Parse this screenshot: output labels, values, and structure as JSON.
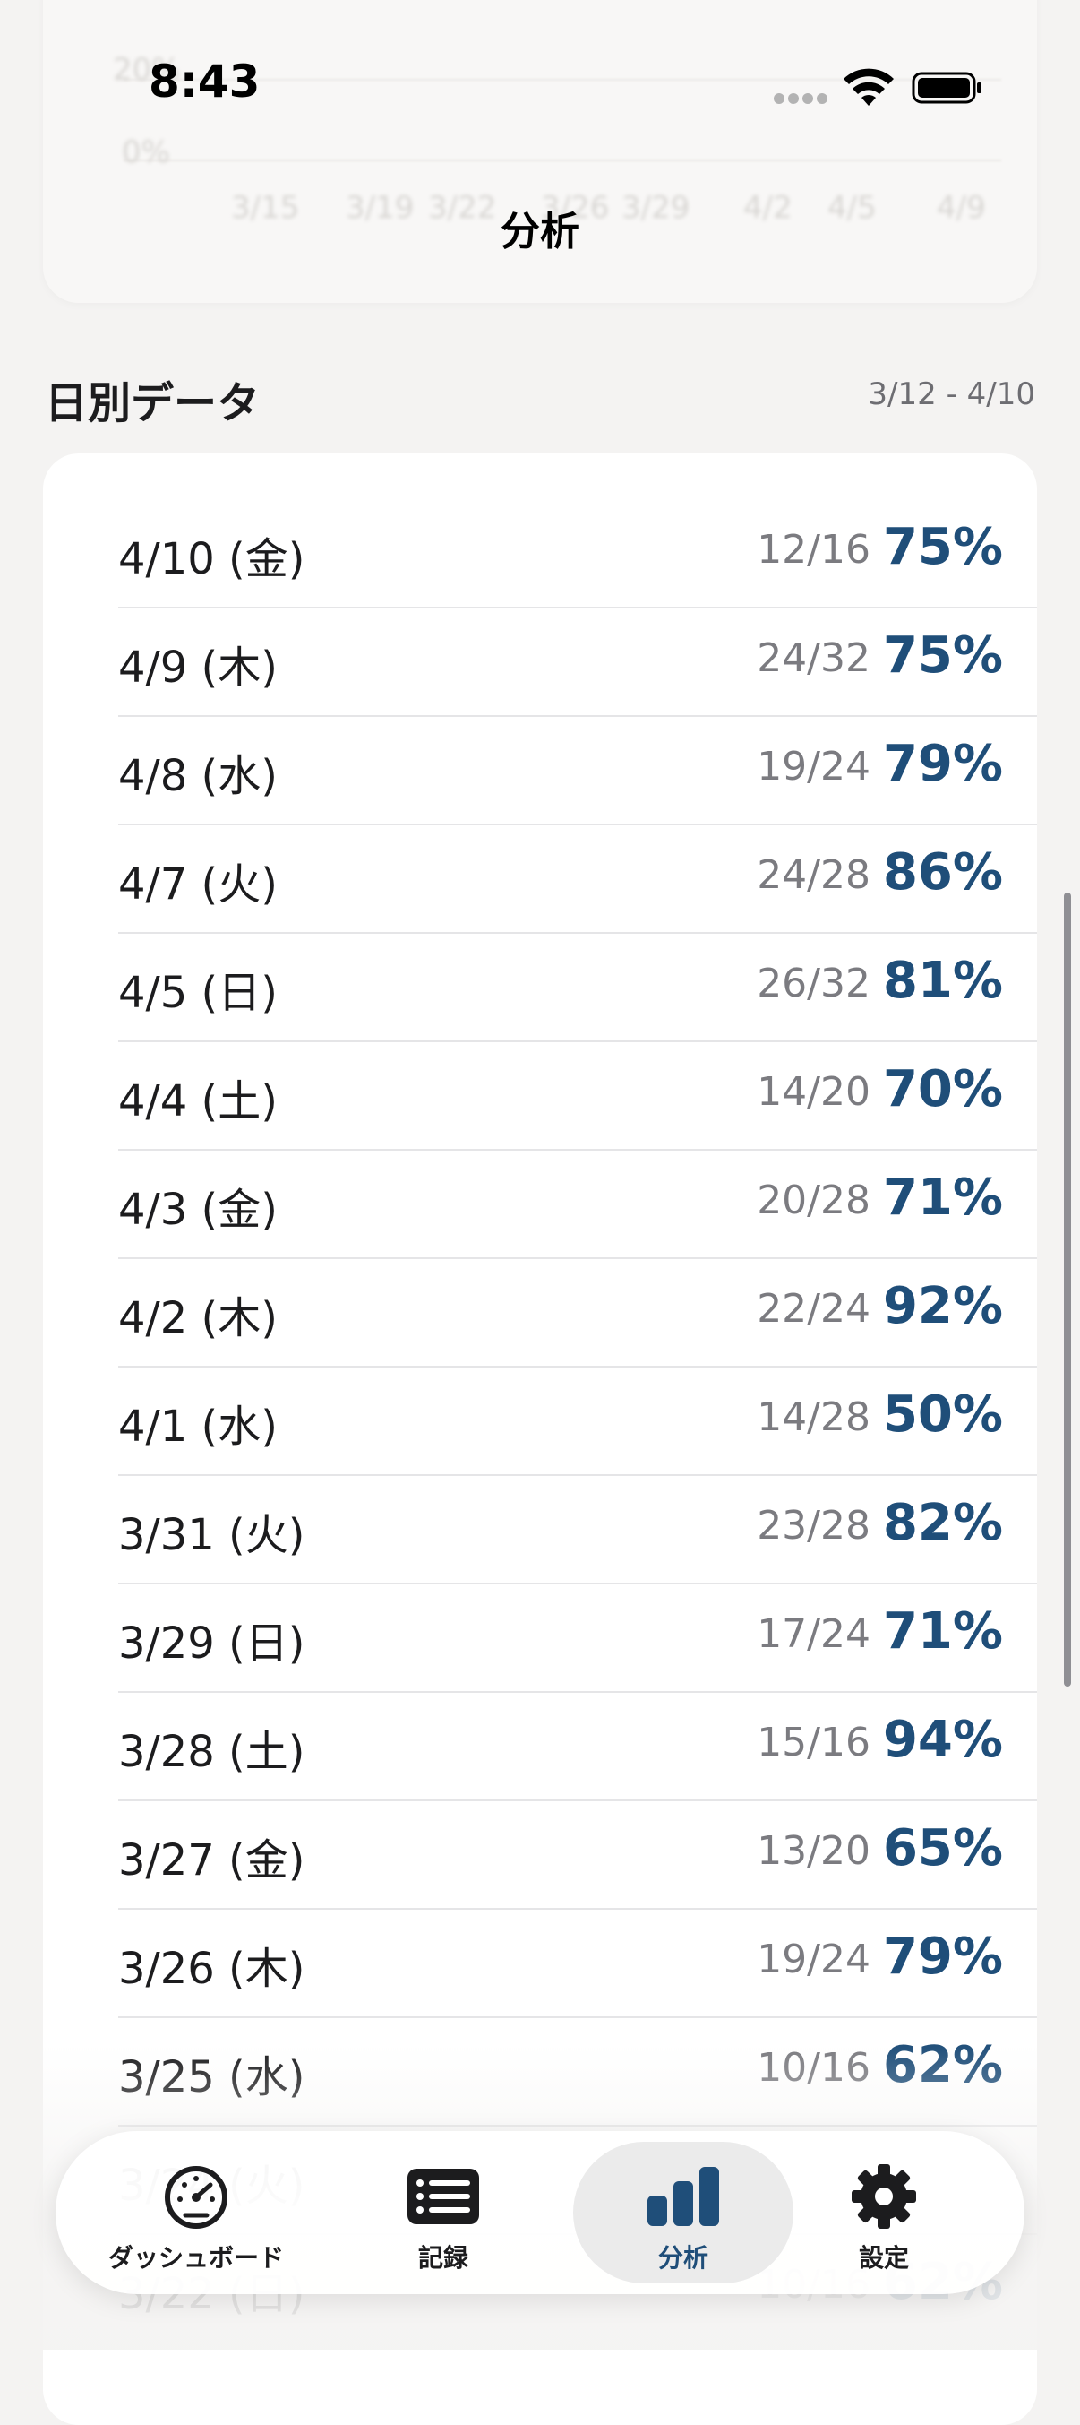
{
  "status_bar": {
    "time": "8:43"
  },
  "nav": {
    "title": "分析"
  },
  "chart_ghost": {
    "y_labels": [
      "20%",
      "0%"
    ],
    "x_labels": [
      "3/15",
      "3/19",
      "3/22",
      "3/26",
      "3/29",
      "4/2",
      "4/5",
      "4/9"
    ]
  },
  "section": {
    "title": "日別データ",
    "range": "3/12 - 4/10"
  },
  "rows": [
    {
      "date": "4/10 (金)",
      "count": "12/16",
      "pct": "75%"
    },
    {
      "date": "4/9 (木)",
      "count": "24/32",
      "pct": "75%"
    },
    {
      "date": "4/8 (水)",
      "count": "19/24",
      "pct": "79%"
    },
    {
      "date": "4/7 (火)",
      "count": "24/28",
      "pct": "86%"
    },
    {
      "date": "4/5 (日)",
      "count": "26/32",
      "pct": "81%"
    },
    {
      "date": "4/4 (土)",
      "count": "14/20",
      "pct": "70%"
    },
    {
      "date": "4/3 (金)",
      "count": "20/28",
      "pct": "71%"
    },
    {
      "date": "4/2 (木)",
      "count": "22/24",
      "pct": "92%"
    },
    {
      "date": "4/1 (水)",
      "count": "14/28",
      "pct": "50%"
    },
    {
      "date": "3/31 (火)",
      "count": "23/28",
      "pct": "82%"
    },
    {
      "date": "3/29 (日)",
      "count": "17/24",
      "pct": "71%"
    },
    {
      "date": "3/28 (土)",
      "count": "15/16",
      "pct": "94%"
    },
    {
      "date": "3/27 (金)",
      "count": "13/20",
      "pct": "65%"
    },
    {
      "date": "3/26 (木)",
      "count": "19/24",
      "pct": "79%"
    },
    {
      "date": "3/25 (水)",
      "count": "10/16",
      "pct": "62%"
    },
    {
      "date": "3/24 (火)",
      "count": "",
      "pct": ""
    },
    {
      "date": "3/22 (日)",
      "count": "10/16",
      "pct": "62%"
    }
  ],
  "tabs": [
    {
      "label": "ダッシュボード",
      "icon": "speedometer-icon",
      "active": false
    },
    {
      "label": "記録",
      "icon": "list-icon",
      "active": false
    },
    {
      "label": "分析",
      "icon": "bar-chart-icon",
      "active": true
    },
    {
      "label": "設定",
      "icon": "gear-icon",
      "active": false
    }
  ],
  "colors": {
    "accent": "#1f4e79",
    "background": "#f4f3f2",
    "card": "#ffffff"
  }
}
